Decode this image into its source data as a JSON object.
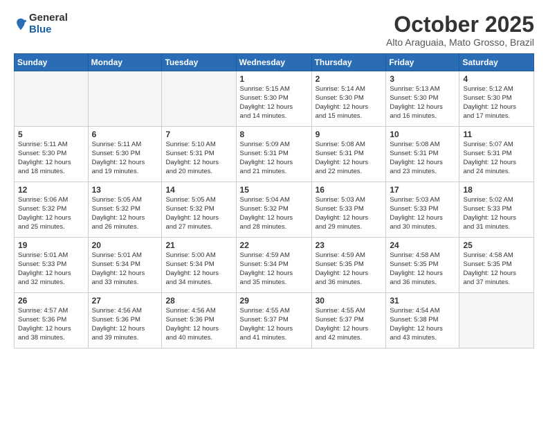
{
  "header": {
    "logo_general": "General",
    "logo_blue": "Blue",
    "month": "October 2025",
    "location": "Alto Araguaia, Mato Grosso, Brazil"
  },
  "days_of_week": [
    "Sunday",
    "Monday",
    "Tuesday",
    "Wednesday",
    "Thursday",
    "Friday",
    "Saturday"
  ],
  "weeks": [
    [
      {
        "day": "",
        "info": ""
      },
      {
        "day": "",
        "info": ""
      },
      {
        "day": "",
        "info": ""
      },
      {
        "day": "1",
        "info": "Sunrise: 5:15 AM\nSunset: 5:30 PM\nDaylight: 12 hours\nand 14 minutes."
      },
      {
        "day": "2",
        "info": "Sunrise: 5:14 AM\nSunset: 5:30 PM\nDaylight: 12 hours\nand 15 minutes."
      },
      {
        "day": "3",
        "info": "Sunrise: 5:13 AM\nSunset: 5:30 PM\nDaylight: 12 hours\nand 16 minutes."
      },
      {
        "day": "4",
        "info": "Sunrise: 5:12 AM\nSunset: 5:30 PM\nDaylight: 12 hours\nand 17 minutes."
      }
    ],
    [
      {
        "day": "5",
        "info": "Sunrise: 5:11 AM\nSunset: 5:30 PM\nDaylight: 12 hours\nand 18 minutes."
      },
      {
        "day": "6",
        "info": "Sunrise: 5:11 AM\nSunset: 5:30 PM\nDaylight: 12 hours\nand 19 minutes."
      },
      {
        "day": "7",
        "info": "Sunrise: 5:10 AM\nSunset: 5:31 PM\nDaylight: 12 hours\nand 20 minutes."
      },
      {
        "day": "8",
        "info": "Sunrise: 5:09 AM\nSunset: 5:31 PM\nDaylight: 12 hours\nand 21 minutes."
      },
      {
        "day": "9",
        "info": "Sunrise: 5:08 AM\nSunset: 5:31 PM\nDaylight: 12 hours\nand 22 minutes."
      },
      {
        "day": "10",
        "info": "Sunrise: 5:08 AM\nSunset: 5:31 PM\nDaylight: 12 hours\nand 23 minutes."
      },
      {
        "day": "11",
        "info": "Sunrise: 5:07 AM\nSunset: 5:31 PM\nDaylight: 12 hours\nand 24 minutes."
      }
    ],
    [
      {
        "day": "12",
        "info": "Sunrise: 5:06 AM\nSunset: 5:32 PM\nDaylight: 12 hours\nand 25 minutes."
      },
      {
        "day": "13",
        "info": "Sunrise: 5:05 AM\nSunset: 5:32 PM\nDaylight: 12 hours\nand 26 minutes."
      },
      {
        "day": "14",
        "info": "Sunrise: 5:05 AM\nSunset: 5:32 PM\nDaylight: 12 hours\nand 27 minutes."
      },
      {
        "day": "15",
        "info": "Sunrise: 5:04 AM\nSunset: 5:32 PM\nDaylight: 12 hours\nand 28 minutes."
      },
      {
        "day": "16",
        "info": "Sunrise: 5:03 AM\nSunset: 5:33 PM\nDaylight: 12 hours\nand 29 minutes."
      },
      {
        "day": "17",
        "info": "Sunrise: 5:03 AM\nSunset: 5:33 PM\nDaylight: 12 hours\nand 30 minutes."
      },
      {
        "day": "18",
        "info": "Sunrise: 5:02 AM\nSunset: 5:33 PM\nDaylight: 12 hours\nand 31 minutes."
      }
    ],
    [
      {
        "day": "19",
        "info": "Sunrise: 5:01 AM\nSunset: 5:33 PM\nDaylight: 12 hours\nand 32 minutes."
      },
      {
        "day": "20",
        "info": "Sunrise: 5:01 AM\nSunset: 5:34 PM\nDaylight: 12 hours\nand 33 minutes."
      },
      {
        "day": "21",
        "info": "Sunrise: 5:00 AM\nSunset: 5:34 PM\nDaylight: 12 hours\nand 34 minutes."
      },
      {
        "day": "22",
        "info": "Sunrise: 4:59 AM\nSunset: 5:34 PM\nDaylight: 12 hours\nand 35 minutes."
      },
      {
        "day": "23",
        "info": "Sunrise: 4:59 AM\nSunset: 5:35 PM\nDaylight: 12 hours\nand 36 minutes."
      },
      {
        "day": "24",
        "info": "Sunrise: 4:58 AM\nSunset: 5:35 PM\nDaylight: 12 hours\nand 36 minutes."
      },
      {
        "day": "25",
        "info": "Sunrise: 4:58 AM\nSunset: 5:35 PM\nDaylight: 12 hours\nand 37 minutes."
      }
    ],
    [
      {
        "day": "26",
        "info": "Sunrise: 4:57 AM\nSunset: 5:36 PM\nDaylight: 12 hours\nand 38 minutes."
      },
      {
        "day": "27",
        "info": "Sunrise: 4:56 AM\nSunset: 5:36 PM\nDaylight: 12 hours\nand 39 minutes."
      },
      {
        "day": "28",
        "info": "Sunrise: 4:56 AM\nSunset: 5:36 PM\nDaylight: 12 hours\nand 40 minutes."
      },
      {
        "day": "29",
        "info": "Sunrise: 4:55 AM\nSunset: 5:37 PM\nDaylight: 12 hours\nand 41 minutes."
      },
      {
        "day": "30",
        "info": "Sunrise: 4:55 AM\nSunset: 5:37 PM\nDaylight: 12 hours\nand 42 minutes."
      },
      {
        "day": "31",
        "info": "Sunrise: 4:54 AM\nSunset: 5:38 PM\nDaylight: 12 hours\nand 43 minutes."
      },
      {
        "day": "",
        "info": ""
      }
    ]
  ]
}
